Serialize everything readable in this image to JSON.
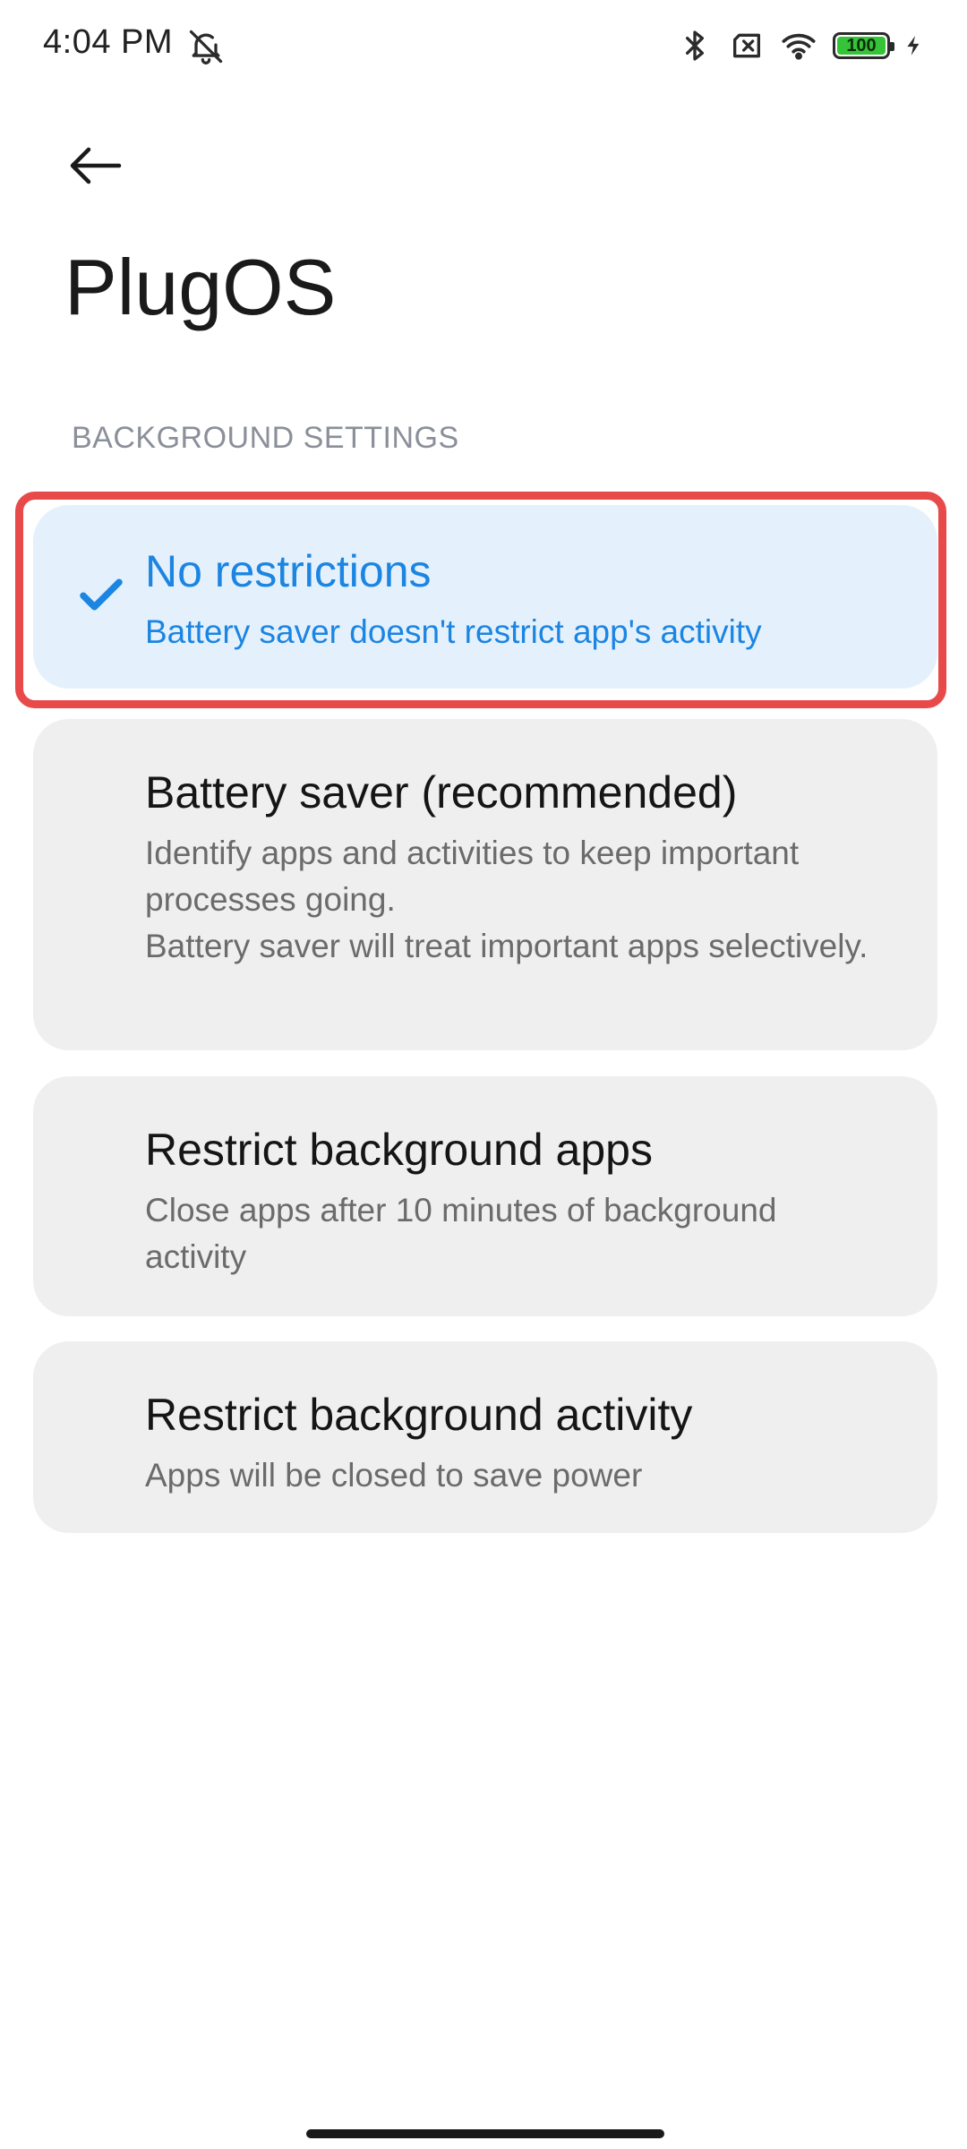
{
  "status_bar": {
    "time": "4:04 PM",
    "battery_level": "100",
    "icons": [
      "mute-notifications-icon",
      "bluetooth-icon",
      "no-sim-icon",
      "wifi-icon",
      "battery-icon",
      "charging-icon"
    ]
  },
  "header": {
    "back_icon": "back-arrow-icon",
    "title": "PlugOS"
  },
  "section": {
    "label": "BACKGROUND SETTINGS"
  },
  "options": [
    {
      "title": "No restrictions",
      "description": "Battery saver doesn't restrict app's activity",
      "selected": true
    },
    {
      "title": "Battery saver (recommended)",
      "description": "Identify apps and activities to keep important processes going.\nBattery saver will treat important apps selectively.",
      "selected": false
    },
    {
      "title": "Restrict background apps",
      "description": "Close apps after 10 minutes of background activity",
      "selected": false
    },
    {
      "title": "Restrict background activity",
      "description": "Apps will be closed to save power",
      "selected": false
    }
  ],
  "colors": {
    "accent": "#1c85e2",
    "selected_background": "#e4f1fd",
    "card_background": "#efefef",
    "highlight_border": "#e84a4a",
    "battery_fill": "#35c437"
  }
}
